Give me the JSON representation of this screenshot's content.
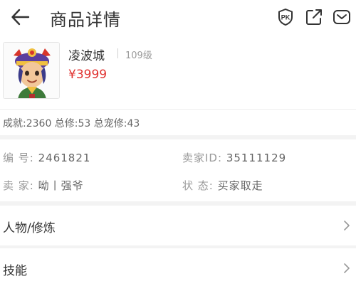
{
  "header": {
    "title": "商品详情",
    "icons": [
      "back-arrow-icon",
      "pk-compare-icon",
      "share-icon",
      "message-icon"
    ]
  },
  "product": {
    "name": "凌波城",
    "level": "109级",
    "price": "¥3999"
  },
  "stats": {
    "text": "成就:2360 总修:53 总宠修:43"
  },
  "info": {
    "number_label": "编  号:",
    "number_value": "2461821",
    "seller_id_label": "卖家ID:",
    "seller_id_value": "35111129",
    "seller_label": "卖  家:",
    "seller_value": "呦丨强爷",
    "status_label": "状  态:",
    "status_value": "买家取走"
  },
  "sections": [
    {
      "label": "人物/修炼"
    },
    {
      "label": "技能"
    }
  ],
  "colors": {
    "price": "#e0312f",
    "text": "#333333",
    "muted": "#999999",
    "divider": "#eeeeee"
  }
}
